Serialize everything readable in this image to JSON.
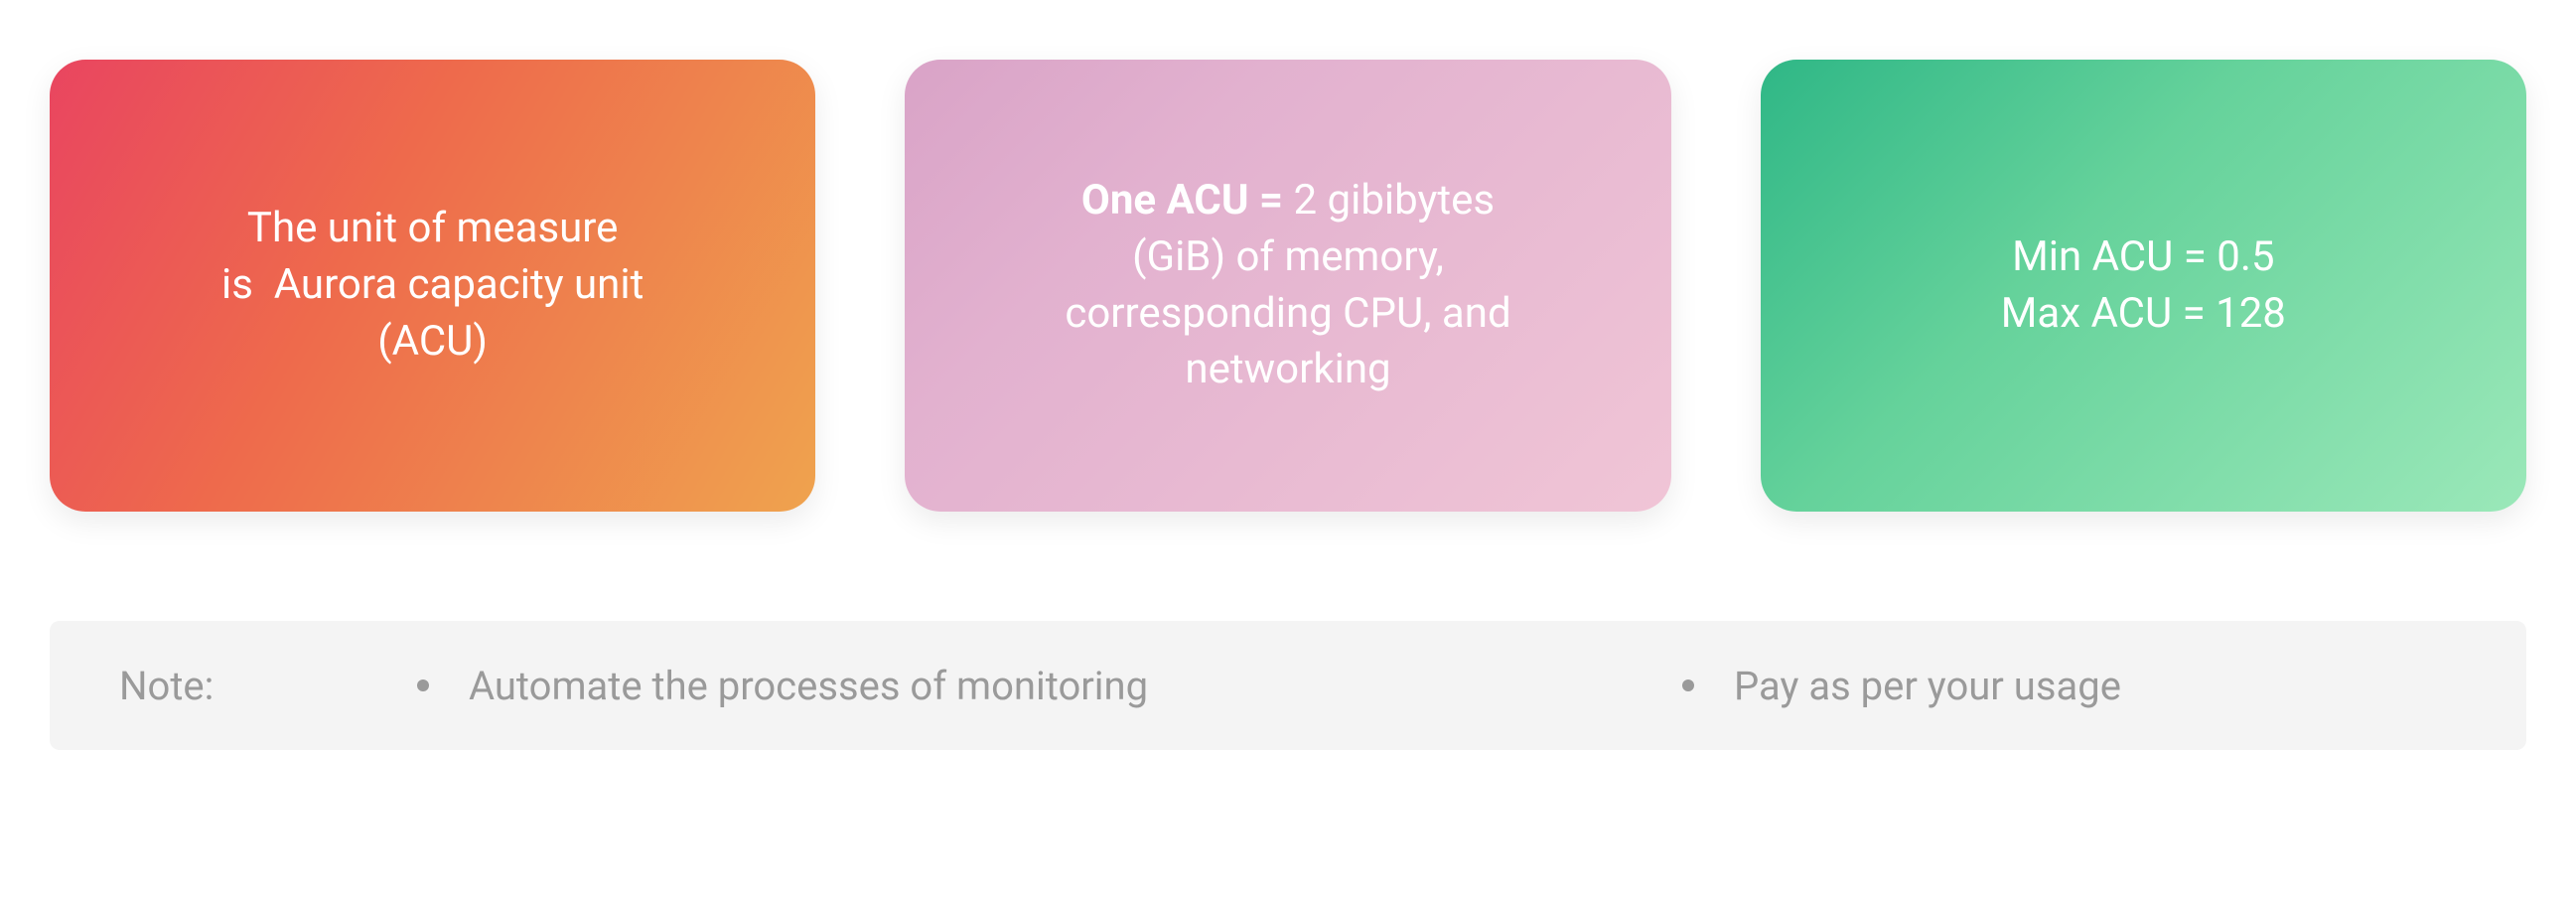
{
  "cards": {
    "c1": {
      "line1": "The unit of measure",
      "line2": "is  Aurora capacity unit",
      "line3": "(ACU)"
    },
    "c2": {
      "bold": "One ACU =",
      "rest1": " 2 gibibytes",
      "line2": "(GiB) of memory,",
      "line3": "corresponding CPU, and",
      "line4": "networking"
    },
    "c3": {
      "line1": "Min ACU = 0.5",
      "line2": "Max ACU = 128"
    }
  },
  "note": {
    "label": "Note:",
    "items": {
      "i1": "Automate the processes of monitoring",
      "i2": "Pay as per your usage"
    }
  }
}
